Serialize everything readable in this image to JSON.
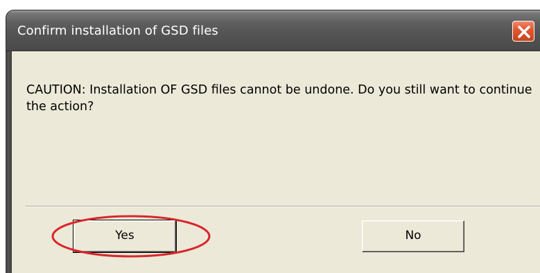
{
  "dialog": {
    "title": "Confirm installation of GSD files",
    "message": "CAUTION: Installation OF GSD files cannot be undone. Do you still want to continue the action?",
    "buttons": {
      "yes_label": "Yes",
      "no_label": "No"
    },
    "close_icon": "close-icon",
    "highlight_color": "#d9262c"
  }
}
